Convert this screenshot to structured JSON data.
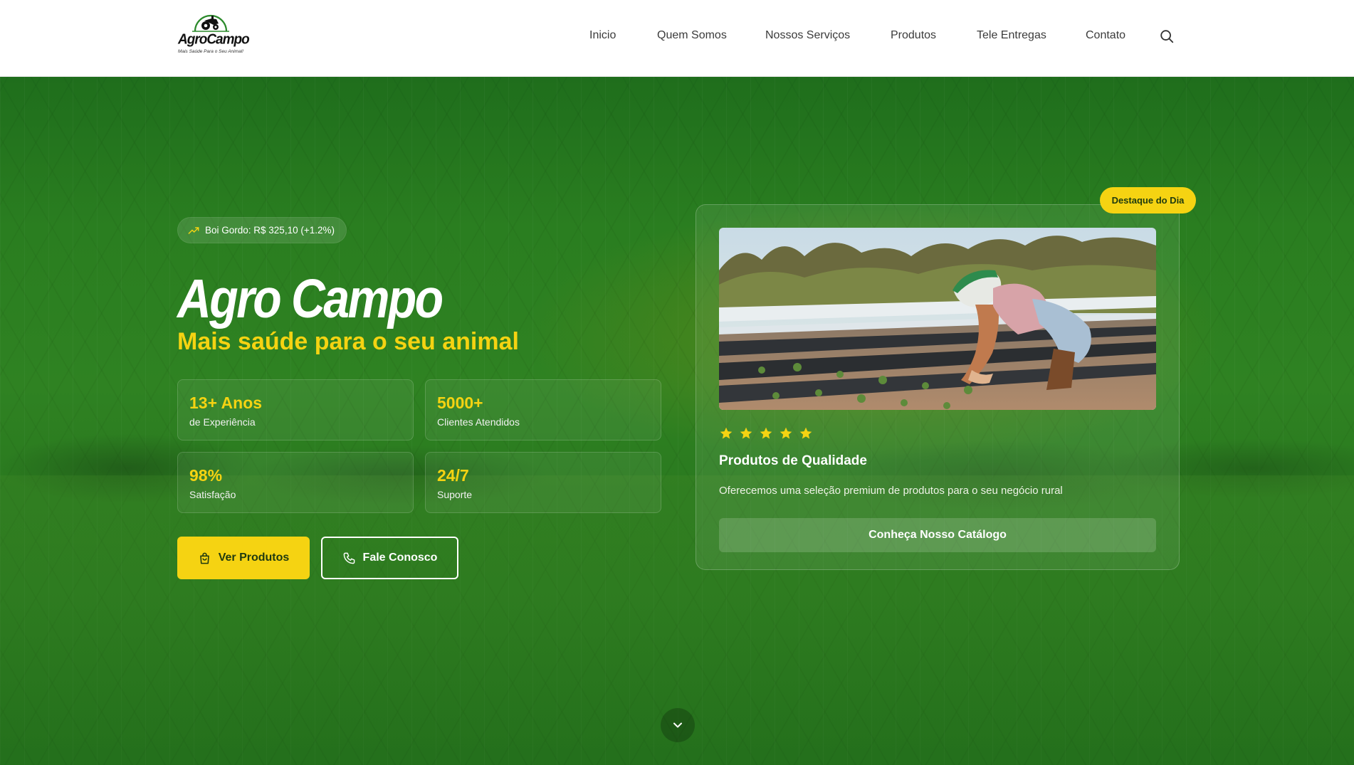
{
  "brand": {
    "logo_text": "AgroCampo",
    "logo_slogan": "Mais Saúde Para o Seu Animal!"
  },
  "nav": {
    "items": [
      {
        "label": "Inicio"
      },
      {
        "label": "Quem Somos"
      },
      {
        "label": "Nossos Serviços"
      },
      {
        "label": "Produtos"
      },
      {
        "label": "Tele Entregas"
      },
      {
        "label": "Contato"
      }
    ],
    "search_icon": "search-icon"
  },
  "hero": {
    "ticker": "Boi Gordo: R$ 325,10 (+1.2%)",
    "title": "Agro Campo",
    "subtitle": "Mais saúde para o seu animal",
    "stats": [
      {
        "value": "13+ Anos",
        "label": "de Experiência"
      },
      {
        "value": "5000+",
        "label": "Clientes Atendidos"
      },
      {
        "value": "98%",
        "label": "Satisfação"
      },
      {
        "value": "24/7",
        "label": "Suporte"
      }
    ],
    "primary_button": "Ver Produtos",
    "secondary_button": "Fale Conosco"
  },
  "featured": {
    "badge": "Destaque do Dia",
    "rating": 5,
    "title": "Produtos de Qualidade",
    "description": "Oferecemos uma seleção premium de produtos para o seu negócio rural",
    "button": "Conheça Nosso Catálogo"
  },
  "colors": {
    "accent_yellow": "#f5d312",
    "hero_green": "#2a7e20",
    "header_bg": "#ffffff"
  }
}
